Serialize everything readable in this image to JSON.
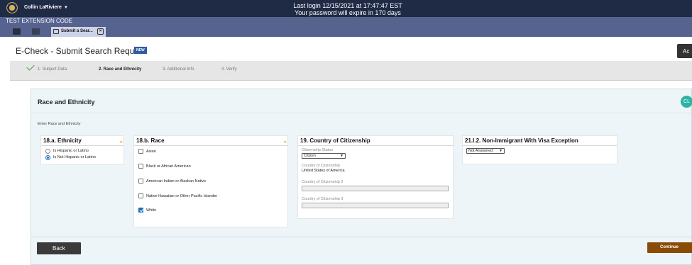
{
  "topbar": {
    "user_name": "Collin LaRiviere",
    "login_line1": "Last login 12/15/2021 at 17:47:47 EST",
    "login_line2": "Your password will expire in 170 days"
  },
  "extension": {
    "label": "TEST EXTENSION CODE",
    "tab_label": "Submit a Sear..."
  },
  "header": {
    "title": "E-Check - Submit Search Request",
    "badge": "NEW",
    "top_button": "Ac"
  },
  "steps": [
    {
      "label": "1. Subject Data",
      "state": "done"
    },
    {
      "label": "2. Race and Ethnicity",
      "state": "active"
    },
    {
      "label": "3. Additional Info",
      "state": "pending"
    },
    {
      "label": "4. Verify",
      "state": "pending"
    }
  ],
  "panel": {
    "title": "Race and Ethnicity",
    "avatar": "CL",
    "intro": "Enter Race and Ethnicity"
  },
  "ethnicity": {
    "heading": "18.a. Ethnicity",
    "options": [
      {
        "label": "Is Hispanic or Latino",
        "selected": false
      },
      {
        "label": "Is Not Hispanic or Latino",
        "selected": true
      }
    ]
  },
  "race": {
    "heading": "18.b. Race",
    "options": [
      {
        "label": "Asian",
        "checked": false
      },
      {
        "label": "Black or African American",
        "checked": false
      },
      {
        "label": "American Indian or Alaskan Native",
        "checked": false
      },
      {
        "label": "Native Hawaiian or Other Pacific Islander",
        "checked": false
      },
      {
        "label": "White",
        "checked": true
      }
    ]
  },
  "citizenship": {
    "heading": "19. Country of Citizenship",
    "status_label": "Citizenship Status",
    "status_value": "Citizen",
    "country_label": "Country of Citizenship",
    "country_value": "United States of America",
    "country2_label": "Country of Citizenship 2",
    "country3_label": "Country of Citizenship 3"
  },
  "visa": {
    "heading": "21.I.2. Non-Immigrant With Visa Exception",
    "select_value": "Not Answered"
  },
  "footer": {
    "back_label": "Back",
    "continue_label": "Continue"
  },
  "colors": {
    "topbar": "#1f2a44",
    "extbar": "#56638e",
    "continue": "#8a4b07",
    "badge": "#2a5ca8",
    "required": "#e28a1e"
  }
}
